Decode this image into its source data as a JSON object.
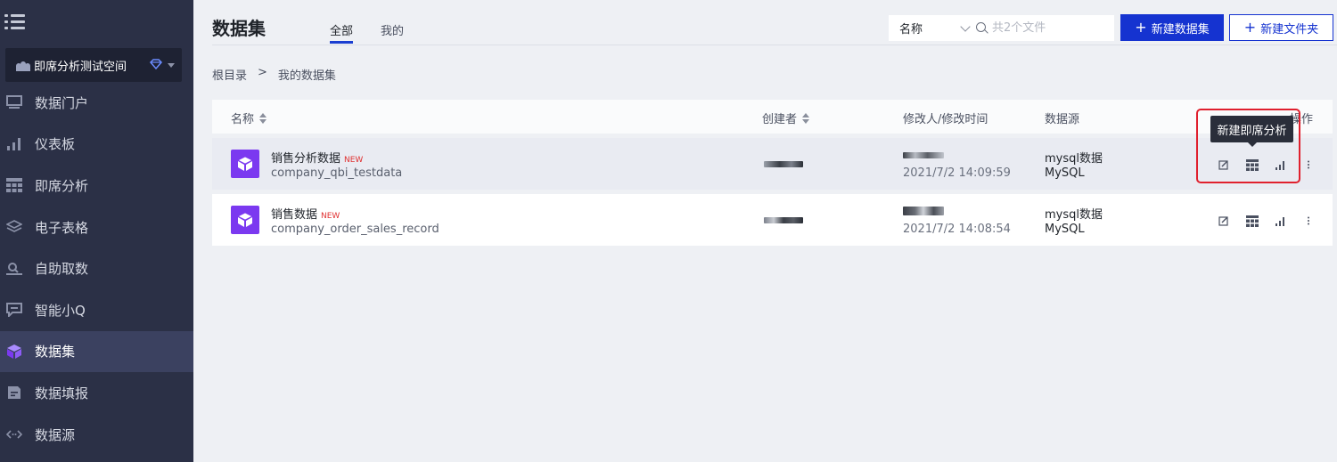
{
  "sidebar": {
    "workspace": "即席分析测试空间",
    "items": [
      {
        "label": "数据门户",
        "icon": "monitor-icon"
      },
      {
        "label": "仪表板",
        "icon": "bar-chart-icon"
      },
      {
        "label": "即席分析",
        "icon": "table-grid-icon"
      },
      {
        "label": "电子表格",
        "icon": "layers-icon"
      },
      {
        "label": "自助取数",
        "icon": "search-data-icon"
      },
      {
        "label": "智能小Q",
        "icon": "chat-icon"
      },
      {
        "label": "数据集",
        "icon": "cube-icon",
        "active": true
      },
      {
        "label": "数据填报",
        "icon": "form-icon"
      },
      {
        "label": "数据源",
        "icon": "code-icon"
      }
    ]
  },
  "header": {
    "title": "数据集",
    "tabs": [
      "全部",
      "我的"
    ],
    "filter_select": "名称",
    "search_placeholder": "共2个文件",
    "btn_new_dataset": "新建数据集",
    "btn_new_folder": "新建文件夹",
    "plus": "+"
  },
  "breadcrumb": {
    "root": "根目录",
    "sep": ">",
    "current": "我的数据集"
  },
  "table": {
    "columns": {
      "name": "名称",
      "creator": "创建者",
      "modified": "修改人/修改时间",
      "source": "数据源",
      "actions": "操作"
    },
    "rows": [
      {
        "name": "销售分析数据",
        "badge": "NEW",
        "table": "company_qbi_testdata",
        "time": "2021/7/2 14:09:59",
        "source_name": "mysql数据",
        "source_type": "MySQL"
      },
      {
        "name": "销售数据",
        "badge": "NEW",
        "table": "company_order_sales_record",
        "time": "2021/7/2 14:08:54",
        "source_name": "mysql数据",
        "source_type": "MySQL"
      }
    ]
  },
  "tooltip": "新建即席分析",
  "colors": {
    "sidebar_bg": "#2b3046",
    "primary": "#1533d0",
    "dataset_icon": "#7b39f0",
    "highlight": "#e0202e",
    "badge": "#e03030"
  }
}
